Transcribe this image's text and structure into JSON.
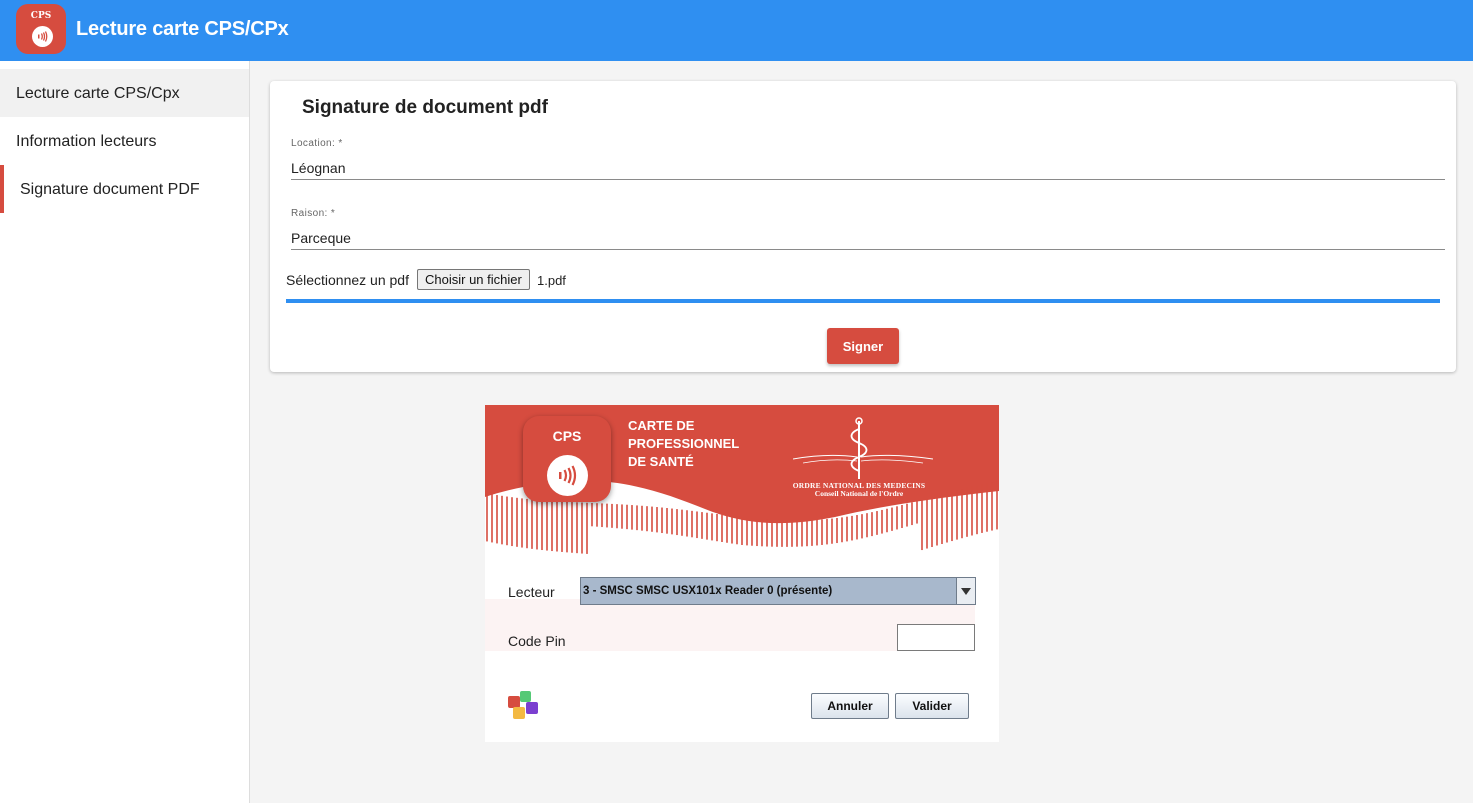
{
  "appbar": {
    "logo_text": "CPS",
    "title": "Lecture carte CPS/CPx"
  },
  "sidebar": {
    "items": [
      {
        "label": "Lecture carte CPS/Cpx"
      },
      {
        "label": "Information lecteurs"
      },
      {
        "label": "Signature document PDF"
      }
    ]
  },
  "form": {
    "title": "Signature de document pdf",
    "location_label": "Location: *",
    "location_value": "Léognan",
    "reason_label": "Raison: *",
    "reason_value": "Parceque",
    "file_label": "Sélectionnez un pdf",
    "file_button": "Choisir un fichier",
    "file_name": "1.pdf",
    "progress_percent": 100,
    "sign_button": "Signer"
  },
  "dialog": {
    "logo_text": "CPS",
    "banner_title_lines": [
      "CARTE DE",
      "PROFESSIONNEL",
      "DE SANTÉ"
    ],
    "order_line1": "ORDRE NATIONAL DES MEDECINS",
    "order_line2": "Conseil National de l'Ordre",
    "reader_label": "Lecteur",
    "reader_value": "3 - SMSC SMSC USX101x Reader  0 (présente)",
    "pin_label": "Code Pin",
    "pin_value": "",
    "cancel_button": "Annuler",
    "validate_button": "Valider"
  },
  "colors": {
    "appbar": "#2f8ff1",
    "accent_red": "#d64c3f",
    "progress": "#2f8ff1",
    "select_highlight": "#a8b8cc"
  }
}
